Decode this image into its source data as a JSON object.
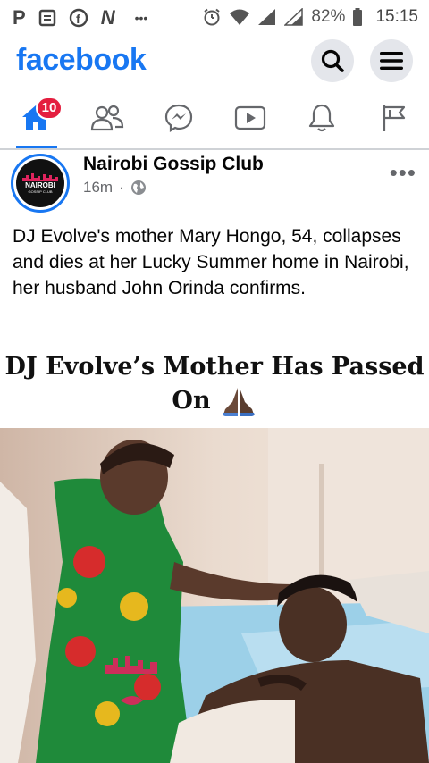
{
  "status_bar": {
    "battery": "82%",
    "time": "15:15",
    "dots": "•••"
  },
  "app": {
    "logo": "facebook"
  },
  "nav": {
    "home_badge": "10"
  },
  "post": {
    "page_name": "Nairobi Gossip Club",
    "time": "16m",
    "separator": "·",
    "more": "•••",
    "avatar_text_1": "NAIROBI",
    "avatar_text_2": "GOSSIP CLUB",
    "text": "DJ Evolve's mother Mary Hongo, 54, collapses and dies at her Lucky Summer home in Nairobi, her husband John Orinda confirms.",
    "headline_line1": "DJ Evolve’s Mother Has Passed",
    "headline_line2": "On"
  },
  "colors": {
    "brand": "#1877f2",
    "badge": "#e41e3f",
    "secondary_text": "#65676b"
  },
  "icons": [
    "p-icon",
    "news-icon",
    "facebook-circle-icon",
    "n-icon",
    "alarm-icon",
    "wifi-icon",
    "signal-icon",
    "battery-icon",
    "search-icon",
    "menu-icon",
    "home-icon",
    "friends-icon",
    "messenger-icon",
    "watch-icon",
    "notifications-icon",
    "pages-flag-icon",
    "globe-icon",
    "praying-hands-icon"
  ]
}
